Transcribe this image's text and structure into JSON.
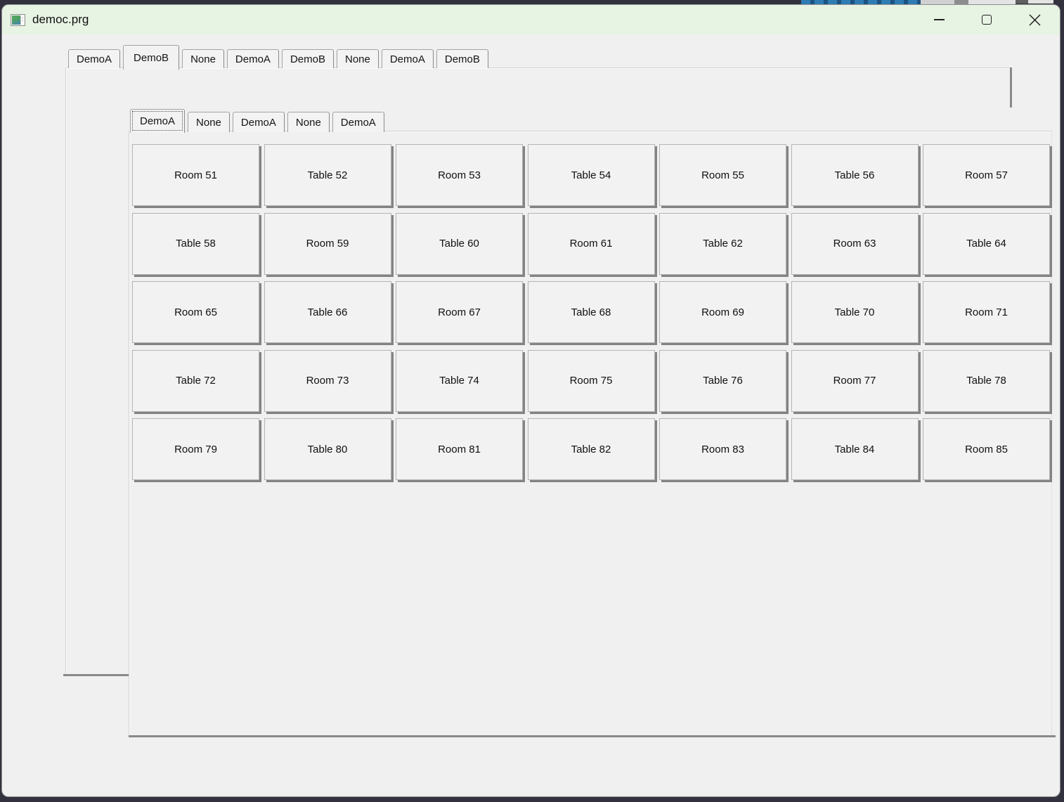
{
  "window": {
    "title": "democ.prg",
    "controls": [
      "minimize",
      "maximize",
      "close"
    ]
  },
  "outer_tab_bar": {
    "tabs": [
      {
        "label": "DemoA",
        "selected": false
      },
      {
        "label": "DemoB",
        "selected": true
      },
      {
        "label": "None",
        "selected": false
      },
      {
        "label": "DemoA",
        "selected": false
      },
      {
        "label": "DemoB",
        "selected": false
      },
      {
        "label": "None",
        "selected": false
      },
      {
        "label": "DemoA",
        "selected": false
      },
      {
        "label": "DemoB",
        "selected": false
      }
    ]
  },
  "inner_tab_bar": {
    "tabs": [
      {
        "label": "DemoA",
        "selected": true
      },
      {
        "label": "None",
        "selected": false
      },
      {
        "label": "DemoA",
        "selected": false
      },
      {
        "label": "None",
        "selected": false
      },
      {
        "label": "DemoA",
        "selected": false
      }
    ]
  },
  "grid": {
    "buttons": [
      "Room 51",
      "Table 52",
      "Room 53",
      "Table 54",
      "Room 55",
      "Table 56",
      "Room 57",
      "Table 58",
      "Room 59",
      "Table 60",
      "Room 61",
      "Table 62",
      "Room 63",
      "Table 64",
      "Room 65",
      "Table 66",
      "Room 67",
      "Table 68",
      "Room 69",
      "Table 70",
      "Room 71",
      "Table 72",
      "Room 73",
      "Table 74",
      "Room 75",
      "Table 76",
      "Room 77",
      "Table 78",
      "Room 79",
      "Table 80",
      "Room 81",
      "Table 82",
      "Room 83",
      "Table 84",
      "Room 85"
    ]
  },
  "colors": {
    "titlebar": "#e7f3e3",
    "window_bg": "#f0f0f0",
    "button_shadow": "#838383",
    "behind_window_blue": "#2e7cb3",
    "desktop_dark": "#32323f"
  }
}
